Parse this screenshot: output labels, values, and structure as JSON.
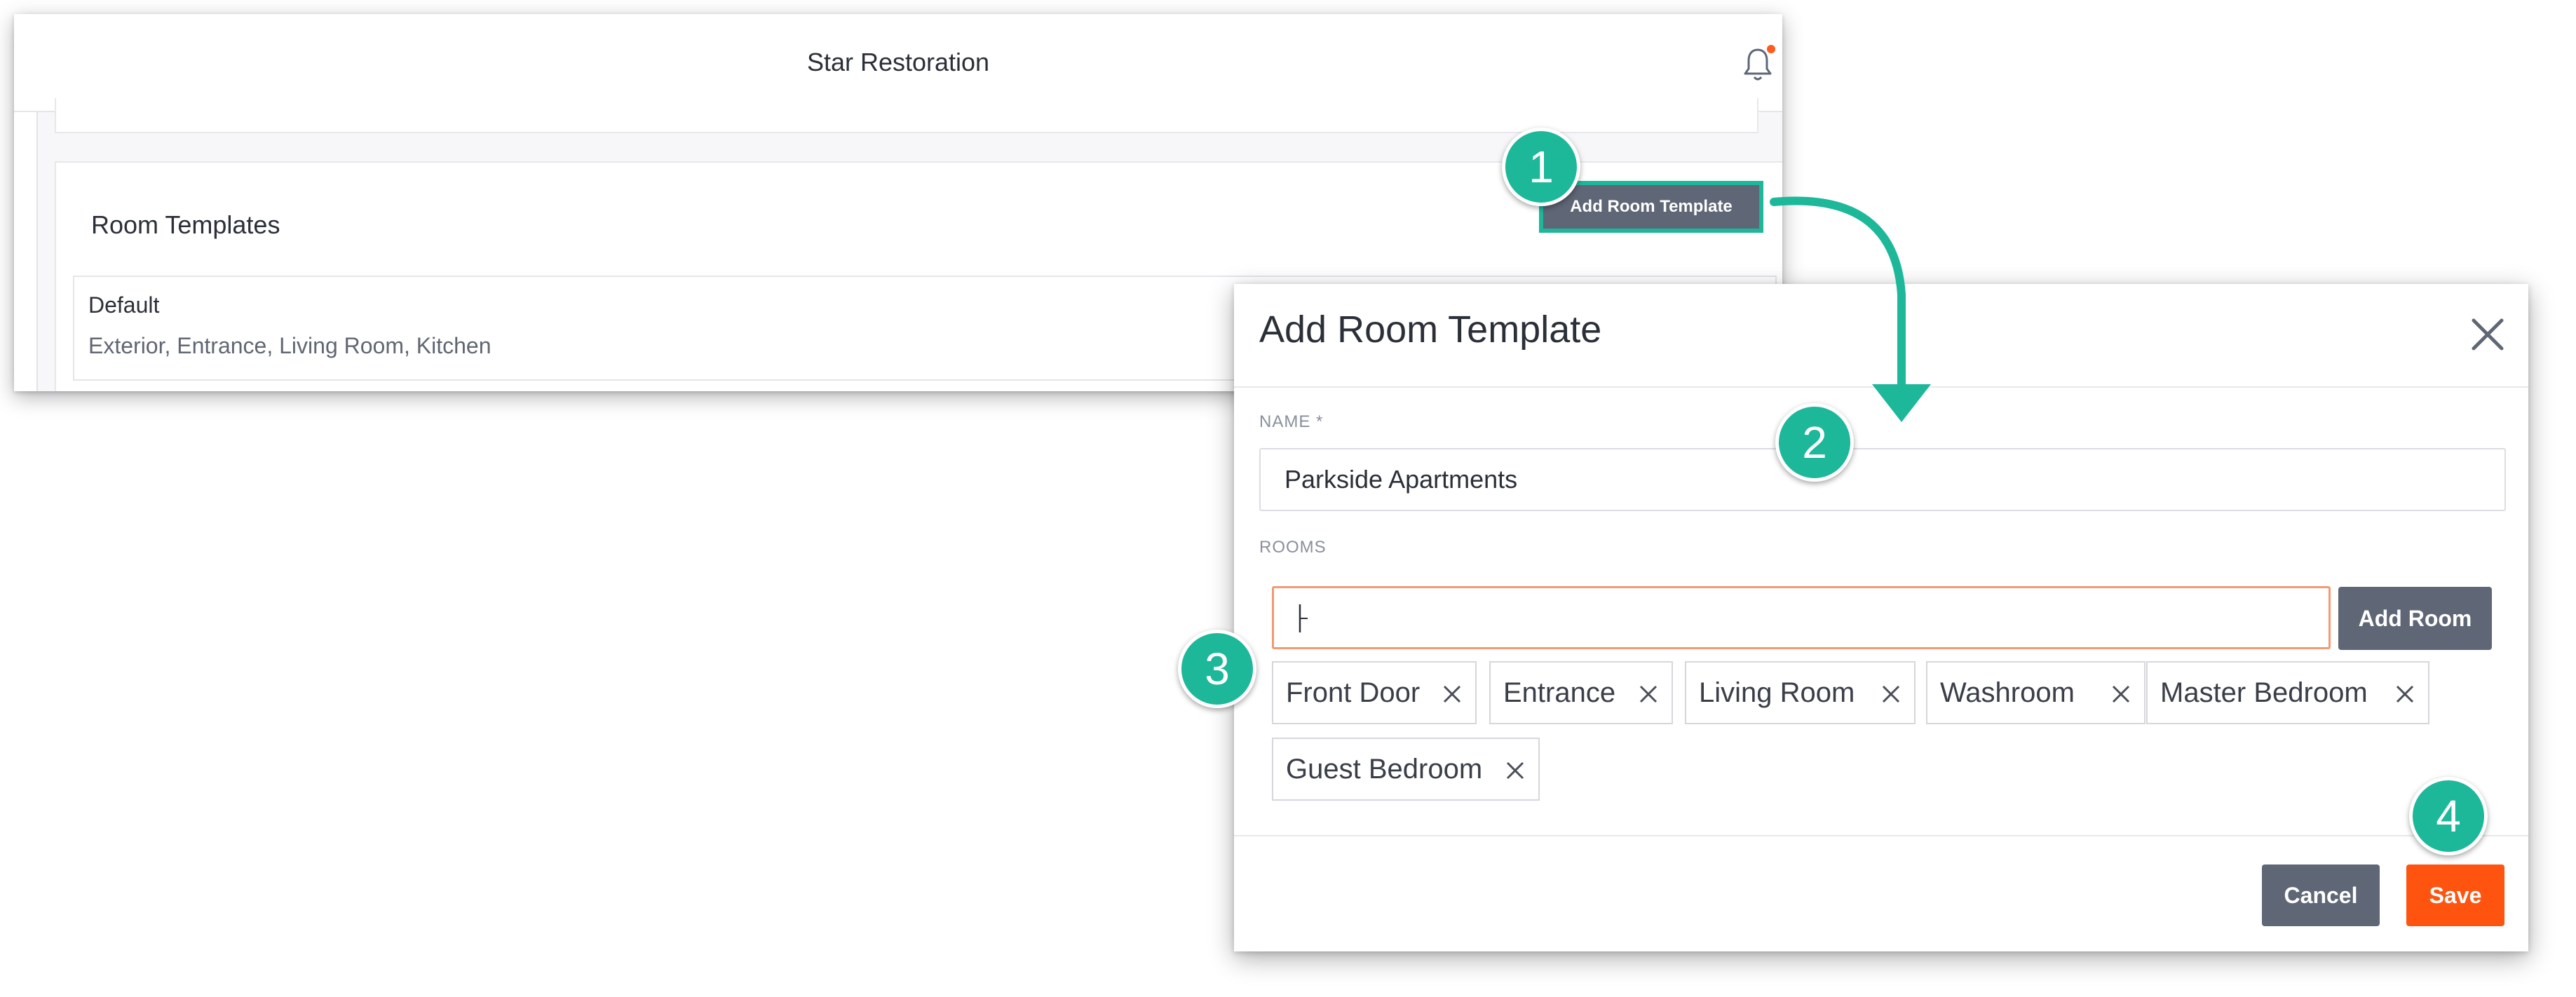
{
  "app": {
    "title": "Star Restoration",
    "icons": {
      "notifications": "bell-icon"
    },
    "notification_dot_color": "#ff5b1f"
  },
  "room_templates_card": {
    "title": "Room Templates",
    "add_button_label": "Add Room Template",
    "templates": [
      {
        "name": "Default",
        "rooms": "Exterior, Entrance, Living Room, Kitchen"
      }
    ]
  },
  "modal": {
    "title": "Add Room Template",
    "close_icon": "close-icon",
    "name_label": "NAME *",
    "name_value": "Parkside Apartments",
    "rooms_label": "ROOMS",
    "room_input_value": "",
    "add_room_label": "Add Room",
    "rooms": [
      {
        "label": "Front Door"
      },
      {
        "label": "Entrance"
      },
      {
        "label": "Living Room"
      },
      {
        "label": "Washroom"
      },
      {
        "label": "Master Bedroom"
      },
      {
        "label": "Guest Bedroom"
      }
    ],
    "cancel_label": "Cancel",
    "save_label": "Save"
  },
  "callouts": [
    "1",
    "2",
    "3",
    "4"
  ],
  "colors": {
    "accent_teal": "#1db79a",
    "primary_orange": "#ff5410",
    "button_gray": "#5f6675",
    "focus_border": "#f29a73"
  }
}
